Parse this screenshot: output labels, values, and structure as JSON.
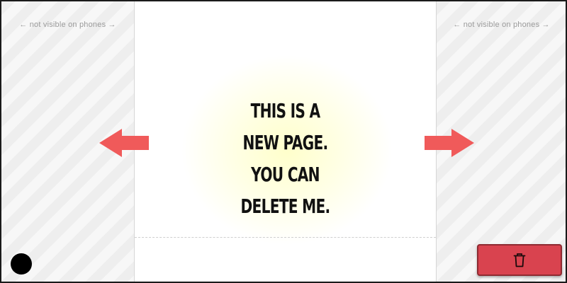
{
  "side_panels": {
    "left_note": "← not visible on phones →",
    "right_note": "← not visible on phones →"
  },
  "page": {
    "headline_lines": [
      "This is a",
      "new page.",
      "You can",
      "delete me."
    ]
  },
  "icons": {
    "left_arrow": "arrow-left-icon",
    "right_arrow": "arrow-right-icon",
    "delete": "trash-icon",
    "dot": "black-dot"
  },
  "colors": {
    "arrow": "#f05a5a",
    "delete_button": "#d9434f",
    "delete_button_border": "#8e2a31",
    "headline": "#111111",
    "glow": "#ffffc8"
  }
}
